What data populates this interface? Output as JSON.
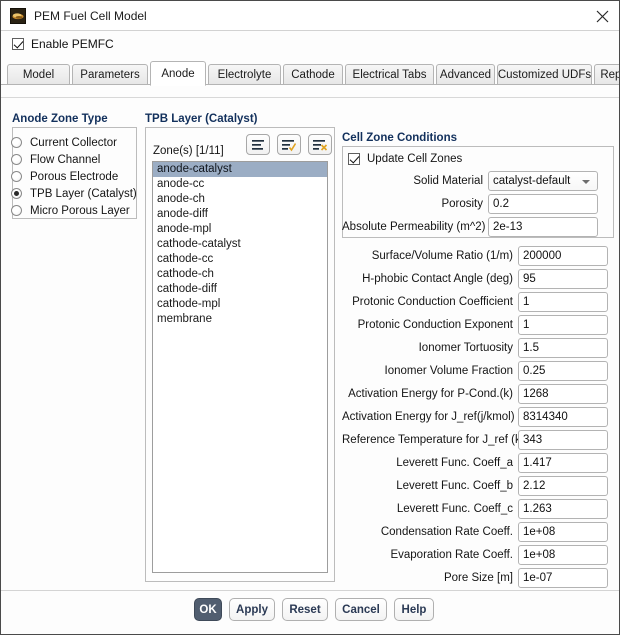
{
  "window": {
    "title": "PEM Fuel Cell Model",
    "icon": "fluent-app-icon",
    "close_icon": "close-icon"
  },
  "enable": {
    "label": "Enable PEMFC",
    "checked": true
  },
  "tabs": [
    {
      "label": "Model",
      "active": false
    },
    {
      "label": "Parameters",
      "active": false
    },
    {
      "label": "Anode",
      "active": true
    },
    {
      "label": "Electrolyte",
      "active": false
    },
    {
      "label": "Cathode",
      "active": false
    },
    {
      "label": "Electrical Tabs",
      "active": false
    },
    {
      "label": "Advanced",
      "active": false
    },
    {
      "label": "Customized UDFs",
      "active": false
    },
    {
      "label": "Reports",
      "active": false
    }
  ],
  "anode_zone_type": {
    "title": "Anode Zone Type",
    "options": [
      {
        "label": "Current Collector",
        "selected": false
      },
      {
        "label": "Flow Channel",
        "selected": false
      },
      {
        "label": "Porous Electrode",
        "selected": false
      },
      {
        "label": "TPB Layer (Catalyst)",
        "selected": true
      },
      {
        "label": "Micro Porous Layer",
        "selected": false
      }
    ]
  },
  "tpb_layer": {
    "title": "TPB Layer (Catalyst)",
    "zones_label": "Zone(s)  [1/11]",
    "toolbar": [
      {
        "icon": "list-icon",
        "name": "list-all-button"
      },
      {
        "icon": "list-check-icon",
        "name": "select-all-button"
      },
      {
        "icon": "list-cross-icon",
        "name": "deselect-all-button"
      }
    ],
    "zones": [
      {
        "label": "anode-catalyst",
        "selected": true
      },
      {
        "label": "anode-cc",
        "selected": false
      },
      {
        "label": "anode-ch",
        "selected": false
      },
      {
        "label": "anode-diff",
        "selected": false
      },
      {
        "label": "anode-mpl",
        "selected": false
      },
      {
        "label": "cathode-catalyst",
        "selected": false
      },
      {
        "label": "cathode-cc",
        "selected": false
      },
      {
        "label": "cathode-ch",
        "selected": false
      },
      {
        "label": "cathode-diff",
        "selected": false
      },
      {
        "label": "cathode-mpl",
        "selected": false
      },
      {
        "label": "membrane",
        "selected": false
      }
    ]
  },
  "cell_zone_conditions": {
    "title": "Cell Zone Conditions",
    "update_cell_zones": {
      "label": "Update Cell Zones",
      "checked": true
    },
    "solid_material": {
      "label": "Solid Material",
      "value": "catalyst-default"
    },
    "porosity": {
      "label": "Porosity",
      "value": "0.2"
    },
    "absolute_permeability": {
      "label": "Absolute Permeability (m^2)",
      "value": "2e-13"
    }
  },
  "parameters": [
    {
      "label": "Surface/Volume Ratio (1/m)",
      "value": "200000"
    },
    {
      "label": "H-phobic Contact Angle (deg)",
      "value": "95"
    },
    {
      "label": "Protonic Conduction Coefficient",
      "value": "1"
    },
    {
      "label": "Protonic Conduction Exponent",
      "value": "1"
    },
    {
      "label": "Ionomer Tortuosity",
      "value": "1.5"
    },
    {
      "label": "Ionomer Volume Fraction",
      "value": "0.25"
    },
    {
      "label": "Activation Energy for P-Cond.(k)",
      "value": "1268"
    },
    {
      "label": "Activation Energy for J_ref(j/kmol)",
      "value": "8314340"
    },
    {
      "label": "Reference Temperature for J_ref (k)",
      "value": "343"
    },
    {
      "label": "Leverett Func. Coeff_a",
      "value": "1.417"
    },
    {
      "label": "Leverett Func. Coeff_b",
      "value": "2.12"
    },
    {
      "label": "Leverett Func. Coeff_c",
      "value": "1.263"
    },
    {
      "label": "Condensation Rate Coeff.",
      "value": "1e+08"
    },
    {
      "label": "Evaporation Rate Coeff.",
      "value": "1e+08"
    },
    {
      "label": "Pore Size [m]",
      "value": "1e-07"
    }
  ],
  "footer_buttons": [
    {
      "label": "OK",
      "primary": true
    },
    {
      "label": "Apply",
      "primary": false
    },
    {
      "label": "Reset",
      "primary": false
    },
    {
      "label": "Cancel",
      "primary": false
    },
    {
      "label": "Help",
      "primary": false
    }
  ],
  "colors": {
    "group_title": "#12305c",
    "selection": "#9badc4",
    "primary_button": "#515e70",
    "button_text": "#2b3a55",
    "icon_accent": "#e0a322"
  }
}
